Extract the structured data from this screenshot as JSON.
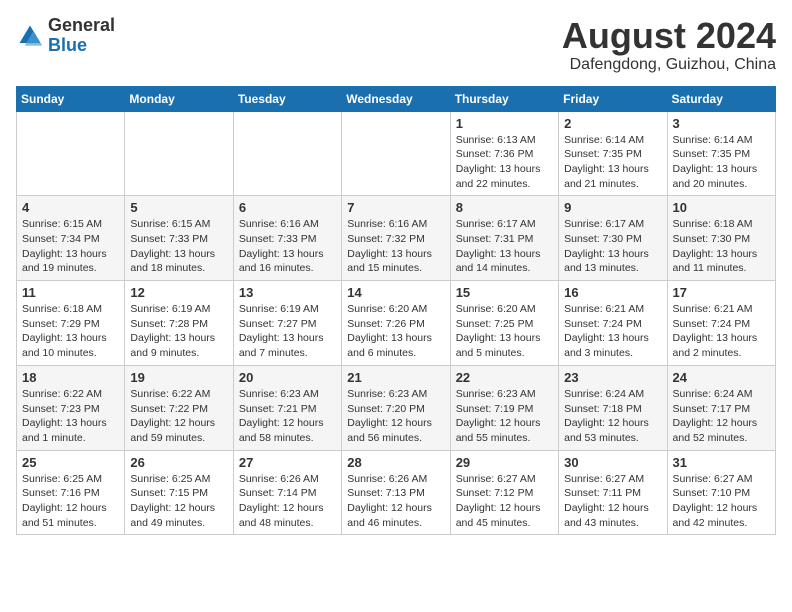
{
  "header": {
    "logo_general": "General",
    "logo_blue": "Blue",
    "month_year": "August 2024",
    "location": "Dafengdong, Guizhou, China"
  },
  "days_of_week": [
    "Sunday",
    "Monday",
    "Tuesday",
    "Wednesday",
    "Thursday",
    "Friday",
    "Saturday"
  ],
  "weeks": [
    [
      {
        "num": "",
        "sunrise": "",
        "sunset": "",
        "daylight": ""
      },
      {
        "num": "",
        "sunrise": "",
        "sunset": "",
        "daylight": ""
      },
      {
        "num": "",
        "sunrise": "",
        "sunset": "",
        "daylight": ""
      },
      {
        "num": "",
        "sunrise": "",
        "sunset": "",
        "daylight": ""
      },
      {
        "num": "1",
        "sunrise": "Sunrise: 6:13 AM",
        "sunset": "Sunset: 7:36 PM",
        "daylight": "Daylight: 13 hours and 22 minutes."
      },
      {
        "num": "2",
        "sunrise": "Sunrise: 6:14 AM",
        "sunset": "Sunset: 7:35 PM",
        "daylight": "Daylight: 13 hours and 21 minutes."
      },
      {
        "num": "3",
        "sunrise": "Sunrise: 6:14 AM",
        "sunset": "Sunset: 7:35 PM",
        "daylight": "Daylight: 13 hours and 20 minutes."
      }
    ],
    [
      {
        "num": "4",
        "sunrise": "Sunrise: 6:15 AM",
        "sunset": "Sunset: 7:34 PM",
        "daylight": "Daylight: 13 hours and 19 minutes."
      },
      {
        "num": "5",
        "sunrise": "Sunrise: 6:15 AM",
        "sunset": "Sunset: 7:33 PM",
        "daylight": "Daylight: 13 hours and 18 minutes."
      },
      {
        "num": "6",
        "sunrise": "Sunrise: 6:16 AM",
        "sunset": "Sunset: 7:33 PM",
        "daylight": "Daylight: 13 hours and 16 minutes."
      },
      {
        "num": "7",
        "sunrise": "Sunrise: 6:16 AM",
        "sunset": "Sunset: 7:32 PM",
        "daylight": "Daylight: 13 hours and 15 minutes."
      },
      {
        "num": "8",
        "sunrise": "Sunrise: 6:17 AM",
        "sunset": "Sunset: 7:31 PM",
        "daylight": "Daylight: 13 hours and 14 minutes."
      },
      {
        "num": "9",
        "sunrise": "Sunrise: 6:17 AM",
        "sunset": "Sunset: 7:30 PM",
        "daylight": "Daylight: 13 hours and 13 minutes."
      },
      {
        "num": "10",
        "sunrise": "Sunrise: 6:18 AM",
        "sunset": "Sunset: 7:30 PM",
        "daylight": "Daylight: 13 hours and 11 minutes."
      }
    ],
    [
      {
        "num": "11",
        "sunrise": "Sunrise: 6:18 AM",
        "sunset": "Sunset: 7:29 PM",
        "daylight": "Daylight: 13 hours and 10 minutes."
      },
      {
        "num": "12",
        "sunrise": "Sunrise: 6:19 AM",
        "sunset": "Sunset: 7:28 PM",
        "daylight": "Daylight: 13 hours and 9 minutes."
      },
      {
        "num": "13",
        "sunrise": "Sunrise: 6:19 AM",
        "sunset": "Sunset: 7:27 PM",
        "daylight": "Daylight: 13 hours and 7 minutes."
      },
      {
        "num": "14",
        "sunrise": "Sunrise: 6:20 AM",
        "sunset": "Sunset: 7:26 PM",
        "daylight": "Daylight: 13 hours and 6 minutes."
      },
      {
        "num": "15",
        "sunrise": "Sunrise: 6:20 AM",
        "sunset": "Sunset: 7:25 PM",
        "daylight": "Daylight: 13 hours and 5 minutes."
      },
      {
        "num": "16",
        "sunrise": "Sunrise: 6:21 AM",
        "sunset": "Sunset: 7:24 PM",
        "daylight": "Daylight: 13 hours and 3 minutes."
      },
      {
        "num": "17",
        "sunrise": "Sunrise: 6:21 AM",
        "sunset": "Sunset: 7:24 PM",
        "daylight": "Daylight: 13 hours and 2 minutes."
      }
    ],
    [
      {
        "num": "18",
        "sunrise": "Sunrise: 6:22 AM",
        "sunset": "Sunset: 7:23 PM",
        "daylight": "Daylight: 13 hours and 1 minute."
      },
      {
        "num": "19",
        "sunrise": "Sunrise: 6:22 AM",
        "sunset": "Sunset: 7:22 PM",
        "daylight": "Daylight: 12 hours and 59 minutes."
      },
      {
        "num": "20",
        "sunrise": "Sunrise: 6:23 AM",
        "sunset": "Sunset: 7:21 PM",
        "daylight": "Daylight: 12 hours and 58 minutes."
      },
      {
        "num": "21",
        "sunrise": "Sunrise: 6:23 AM",
        "sunset": "Sunset: 7:20 PM",
        "daylight": "Daylight: 12 hours and 56 minutes."
      },
      {
        "num": "22",
        "sunrise": "Sunrise: 6:23 AM",
        "sunset": "Sunset: 7:19 PM",
        "daylight": "Daylight: 12 hours and 55 minutes."
      },
      {
        "num": "23",
        "sunrise": "Sunrise: 6:24 AM",
        "sunset": "Sunset: 7:18 PM",
        "daylight": "Daylight: 12 hours and 53 minutes."
      },
      {
        "num": "24",
        "sunrise": "Sunrise: 6:24 AM",
        "sunset": "Sunset: 7:17 PM",
        "daylight": "Daylight: 12 hours and 52 minutes."
      }
    ],
    [
      {
        "num": "25",
        "sunrise": "Sunrise: 6:25 AM",
        "sunset": "Sunset: 7:16 PM",
        "daylight": "Daylight: 12 hours and 51 minutes."
      },
      {
        "num": "26",
        "sunrise": "Sunrise: 6:25 AM",
        "sunset": "Sunset: 7:15 PM",
        "daylight": "Daylight: 12 hours and 49 minutes."
      },
      {
        "num": "27",
        "sunrise": "Sunrise: 6:26 AM",
        "sunset": "Sunset: 7:14 PM",
        "daylight": "Daylight: 12 hours and 48 minutes."
      },
      {
        "num": "28",
        "sunrise": "Sunrise: 6:26 AM",
        "sunset": "Sunset: 7:13 PM",
        "daylight": "Daylight: 12 hours and 46 minutes."
      },
      {
        "num": "29",
        "sunrise": "Sunrise: 6:27 AM",
        "sunset": "Sunset: 7:12 PM",
        "daylight": "Daylight: 12 hours and 45 minutes."
      },
      {
        "num": "30",
        "sunrise": "Sunrise: 6:27 AM",
        "sunset": "Sunset: 7:11 PM",
        "daylight": "Daylight: 12 hours and 43 minutes."
      },
      {
        "num": "31",
        "sunrise": "Sunrise: 6:27 AM",
        "sunset": "Sunset: 7:10 PM",
        "daylight": "Daylight: 12 hours and 42 minutes."
      }
    ]
  ]
}
